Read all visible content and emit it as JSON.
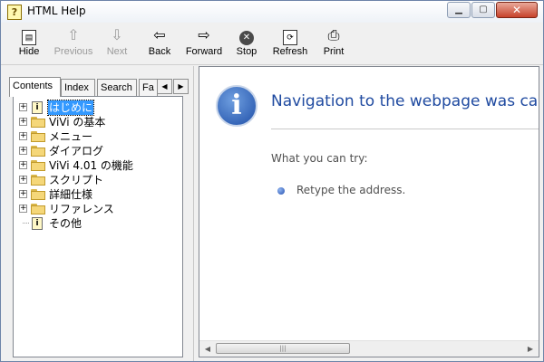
{
  "window": {
    "title": "HTML Help"
  },
  "toolbar": {
    "hide": "Hide",
    "previous": "Previous",
    "next": "Next",
    "back": "Back",
    "forward": "Forward",
    "stop": "Stop",
    "refresh": "Refresh",
    "print": "Print"
  },
  "tabs": [
    "Contents",
    "Index",
    "Search",
    "Fa"
  ],
  "tree": [
    {
      "label": "はじめに",
      "icon": "page-icon",
      "expander": true,
      "selected": true
    },
    {
      "label": "ViVi の基本",
      "icon": "folder-icon",
      "expander": true,
      "selected": false
    },
    {
      "label": "メニュー",
      "icon": "folder-icon",
      "expander": true,
      "selected": false
    },
    {
      "label": "ダイアログ",
      "icon": "folder-icon",
      "expander": true,
      "selected": false
    },
    {
      "label": "ViVi 4.01 の機能",
      "icon": "folder-icon",
      "expander": true,
      "selected": false
    },
    {
      "label": "スクリプト",
      "icon": "folder-icon",
      "expander": true,
      "selected": false
    },
    {
      "label": "詳細仕様",
      "icon": "folder-icon",
      "expander": true,
      "selected": false
    },
    {
      "label": "リファレンス",
      "icon": "folder-icon",
      "expander": true,
      "selected": false
    },
    {
      "label": "その他",
      "icon": "page-icon",
      "expander": false,
      "selected": false
    }
  ],
  "content": {
    "heading": "Navigation to the webpage was can",
    "subheading": "What you can try:",
    "bullet": "Retype the address."
  },
  "colors": {
    "accent": "#1f4aa0",
    "selection": "#3399ff"
  }
}
